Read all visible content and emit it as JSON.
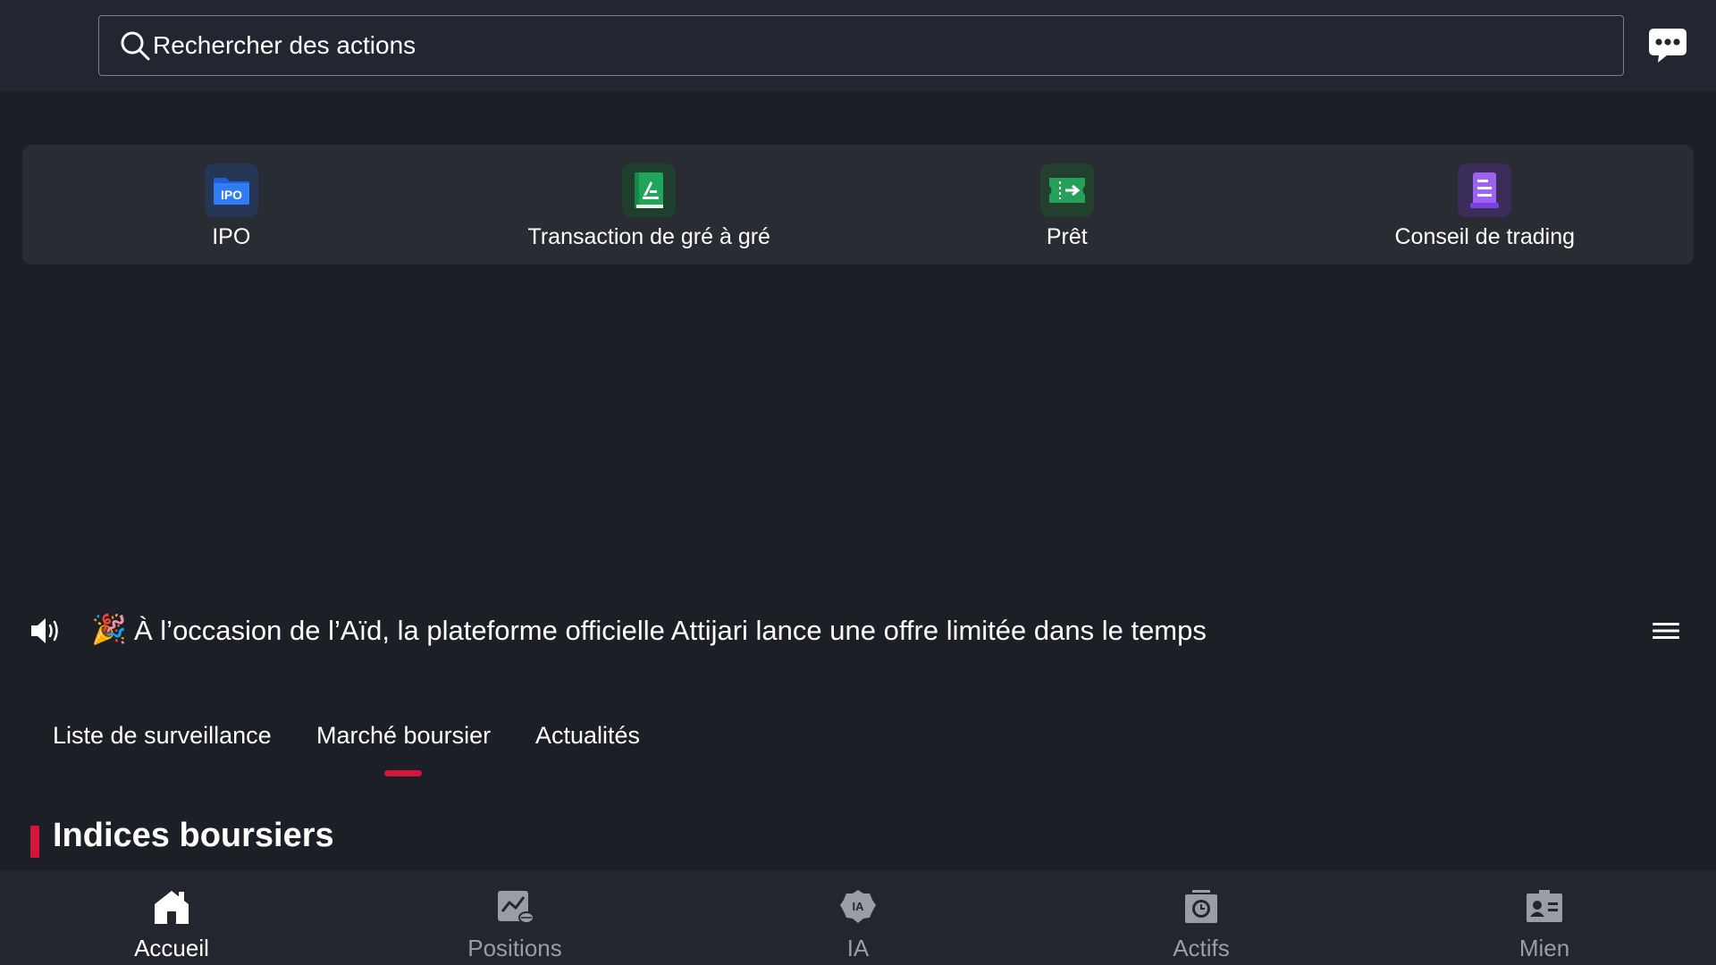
{
  "search": {
    "placeholder": "Rechercher des actions"
  },
  "quick_actions": [
    {
      "label": "IPO",
      "icon": "ipo-icon",
      "icon_text": "IPO",
      "color": "#2f7cf6"
    },
    {
      "label": "Transaction de gré à gré",
      "icon": "otc-book-icon",
      "color": "#1fa65a"
    },
    {
      "label": "Prêt",
      "icon": "loan-ticket-icon",
      "color": "#27a05c"
    },
    {
      "label": "Conseil de trading",
      "icon": "advice-document-icon",
      "color": "#8a4fe0"
    }
  ],
  "announcement": {
    "emoji": "🎉",
    "text": "À l’occasion de l’Aïd, la plateforme officielle Attijari lance une offre limitée dans le temps"
  },
  "tabs": [
    {
      "label": "Liste de surveillance",
      "active": false
    },
    {
      "label": "Marché boursier",
      "active": true
    },
    {
      "label": "Actualités",
      "active": false
    }
  ],
  "section": {
    "title": "Indices boursiers"
  },
  "bottom_nav": [
    {
      "label": "Accueil",
      "icon": "home-icon",
      "active": true
    },
    {
      "label": "Positions",
      "icon": "positions-chart-icon",
      "active": false
    },
    {
      "label": "IA",
      "icon": "ai-badge-icon",
      "icon_text": "IA",
      "active": false
    },
    {
      "label": "Actifs",
      "icon": "assets-clock-icon",
      "active": false
    },
    {
      "label": "Mien",
      "icon": "profile-card-icon",
      "active": false
    }
  ],
  "colors": {
    "background": "#1c1f26",
    "accent": "#d5163b",
    "inactive_text": "#9a9da3"
  }
}
